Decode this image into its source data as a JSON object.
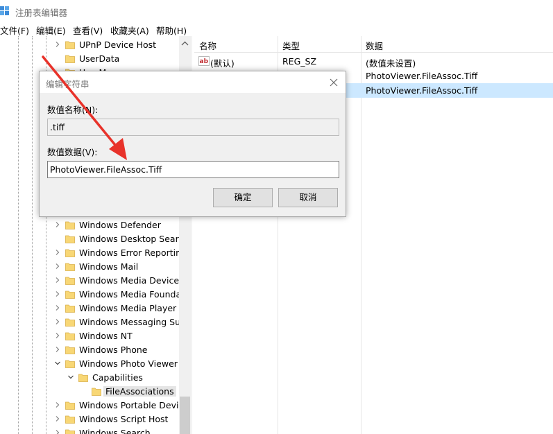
{
  "window": {
    "title": "注册表编辑器",
    "icon": "regedit-icon"
  },
  "menu": [
    "文件(F)",
    "编辑(E)",
    "查看(V)",
    "收藏夹(A)",
    "帮助(H)"
  ],
  "tree": {
    "items": [
      {
        "label": "UPnP Device Host",
        "expander": "collapsed",
        "level": 0
      },
      {
        "label": "UserData",
        "expander": "none",
        "level": 0
      },
      {
        "label": "UserManager",
        "expander": "none",
        "level": 0
      },
      {
        "label": "Windows Defender",
        "expander": "collapsed",
        "level": 0
      },
      {
        "label": "Windows Desktop Search",
        "expander": "none",
        "level": 0
      },
      {
        "label": "Windows Error Reporting",
        "expander": "collapsed",
        "level": 0
      },
      {
        "label": "Windows Mail",
        "expander": "collapsed",
        "level": 0
      },
      {
        "label": "Windows Media Device M",
        "expander": "collapsed",
        "level": 0
      },
      {
        "label": "Windows Media Foundati",
        "expander": "collapsed",
        "level": 0
      },
      {
        "label": "Windows Media Player N",
        "expander": "collapsed",
        "level": 0
      },
      {
        "label": "Windows Messaging Sub",
        "expander": "collapsed",
        "level": 0
      },
      {
        "label": "Windows NT",
        "expander": "collapsed",
        "level": 0
      },
      {
        "label": "Windows Phone",
        "expander": "collapsed",
        "level": 0
      },
      {
        "label": "Windows Photo Viewer",
        "expander": "expanded",
        "level": 0
      },
      {
        "label": "Capabilities",
        "expander": "expanded",
        "level": 1
      },
      {
        "label": "FileAssociations",
        "expander": "none",
        "level": 2,
        "selected": true
      },
      {
        "label": "Windows Portable Device",
        "expander": "collapsed",
        "level": 0
      },
      {
        "label": "Windows Script Host",
        "expander": "collapsed",
        "level": 0
      },
      {
        "label": "Windows Search",
        "expander": "collapsed",
        "level": 0
      }
    ]
  },
  "list": {
    "columns": [
      "名称",
      "类型",
      "数据"
    ],
    "rows": [
      {
        "name": "(默认)",
        "type": "REG_SZ",
        "data": "(数值未设置)",
        "icon": "string-value-icon"
      },
      {
        "name": "",
        "type": "",
        "data": "PhotoViewer.FileAssoc.Tiff"
      },
      {
        "name": "",
        "type": "",
        "data": "PhotoViewer.FileAssoc.Tiff",
        "selected": true
      }
    ]
  },
  "dialog": {
    "title": "编辑字符串",
    "name_label": "数值名称(N):",
    "name_value": ".tiff",
    "data_label": "数值数据(V):",
    "data_value": "PhotoViewer.FileAssoc.Tiff",
    "ok_label": "确定",
    "cancel_label": "取消"
  },
  "colors": {
    "selection": "#cce8ff",
    "folder": "#f8d775",
    "annotation_arrow": "#e8322a"
  }
}
